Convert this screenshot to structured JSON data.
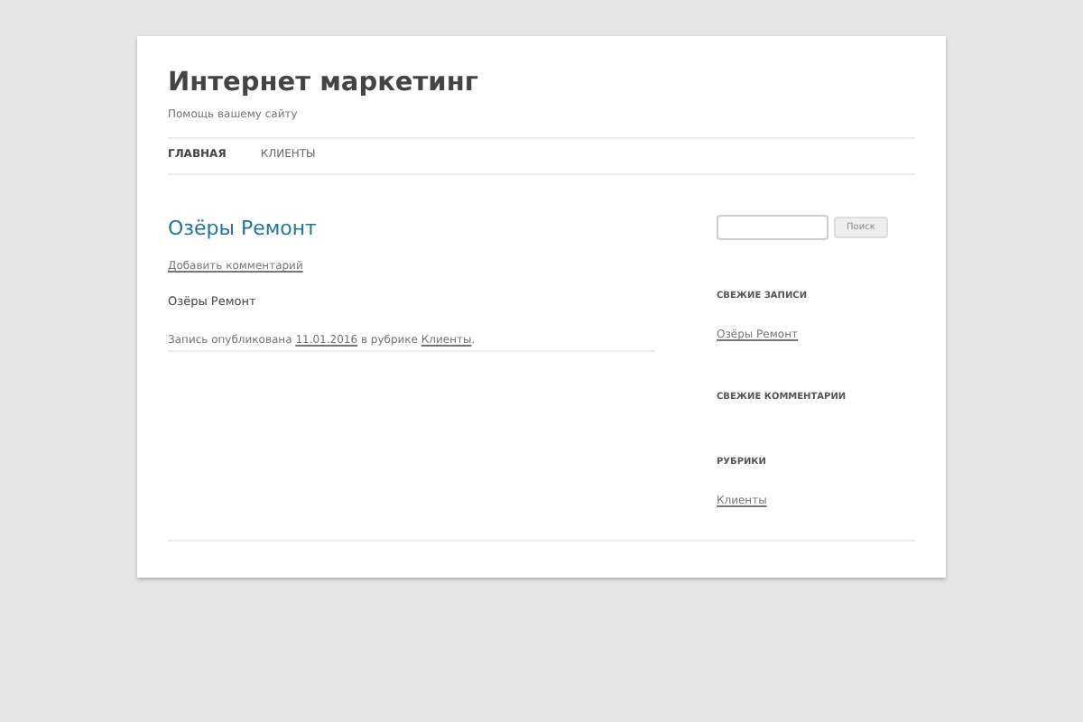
{
  "site": {
    "title": "Интернет маркетинг",
    "tagline": "Помощь вашему сайту"
  },
  "nav": [
    {
      "label": "ГЛАВНАЯ",
      "selected": true
    },
    {
      "label": "КЛИЕНТЫ",
      "selected": false
    }
  ],
  "post": {
    "title": "Озёры Ремонт",
    "comment_link": "Добавить комментарий",
    "body": "Озёры Ремонт",
    "meta": {
      "prefix": "Запись опубликована",
      "date": "11.01.2016",
      "middle": "в рубрике",
      "category": "Клиенты",
      "suffix": "."
    }
  },
  "sidebar": {
    "search_button": "Поиск",
    "widgets": [
      {
        "title": "СВЕЖИЕ ЗАПИСИ",
        "links": [
          "Озёры Ремонт"
        ]
      },
      {
        "title": "СВЕЖИЕ КОММЕНТАРИИ"
      },
      {
        "title": "РУБРИКИ",
        "links": [
          "Клиенты"
        ]
      }
    ]
  }
}
